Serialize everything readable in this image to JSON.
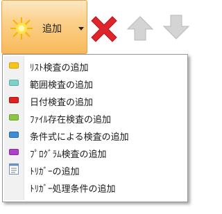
{
  "toolbar": {
    "add_label": "追加",
    "icons": {
      "add": "star-icon",
      "delete": "delete-x-icon",
      "move_up": "arrow-up-icon",
      "move_down": "arrow-down-icon"
    },
    "colors": {
      "add_button_top": "#fde8c2",
      "add_button_bottom": "#f8b95a",
      "delete": "#e0242c",
      "disabled_arrow": "#c8c8c8"
    }
  },
  "menu": {
    "items": [
      {
        "label": "ﾘｽﾄ検査の追加",
        "icon": "yellow-swatch-icon",
        "color": "#f5c518"
      },
      {
        "label": "範囲検査の追加",
        "icon": "teal-swatch-icon",
        "color": "#7fd0c6"
      },
      {
        "label": "日付検査の追加",
        "icon": "red-swatch-icon",
        "color": "#e02020"
      },
      {
        "label": "ﾌｧｲﾙ存在検査の追加",
        "icon": "green-swatch-icon",
        "color": "#8cc63f"
      },
      {
        "label": "条件式による検査の追加",
        "icon": "blue-swatch-icon",
        "color": "#3a8fd6"
      },
      {
        "label": "ﾌﾟﾛｸﾞﾗﾑ検査の追加",
        "icon": "purple-swatch-icon",
        "color": "#b040c8"
      },
      {
        "label": "ﾄﾘｶﾞｰの追加",
        "icon": "document-list-icon",
        "color": "#6a8fc0"
      },
      {
        "label": "ﾄﾘｶﾞｰ処理条件の追加",
        "icon": "",
        "color": ""
      }
    ]
  }
}
